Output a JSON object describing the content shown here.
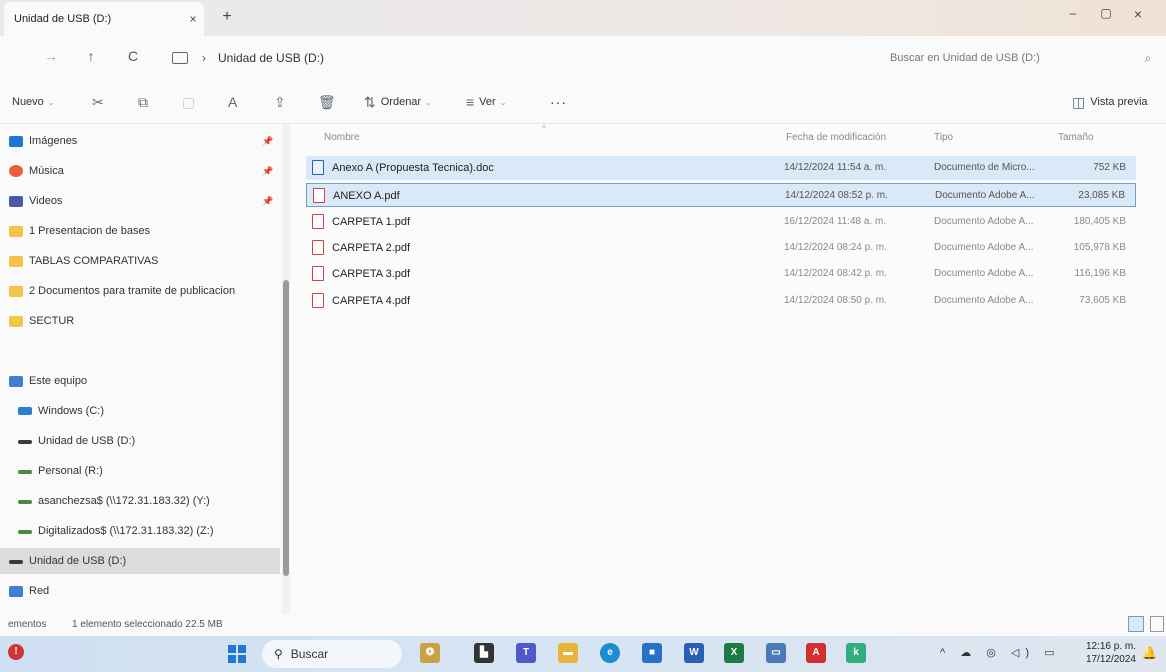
{
  "window": {
    "tab_title": "Unidad de USB (D:)",
    "tab_close": "×",
    "new_tab": "+",
    "minimize": "–",
    "maximize": "▢",
    "close": "×"
  },
  "address": {
    "back": "→",
    "up": "↑",
    "refresh": "C",
    "chevron": "›",
    "path": "Unidad de USB (D:)",
    "search_placeholder": "Buscar en Unidad de USB (D:)",
    "search_glyph": "⌕"
  },
  "toolbar": {
    "new_label": "Nuevo",
    "sort_label": "Ordenar",
    "view_label": "Ver",
    "more_label": "···",
    "preview_label": "Vista previa",
    "caret": "⌄",
    "icons": {
      "cut": "✂",
      "copy": "⧉",
      "paste": "▢",
      "rename": "A",
      "share": "⇪",
      "delete": "🗑",
      "sort": "⇅",
      "view": "≡",
      "preview": "◫"
    }
  },
  "sidebar": {
    "pin": "📌",
    "items": [
      {
        "label": "Imágenes",
        "icon": "images-icon"
      },
      {
        "label": "Música",
        "icon": "music-icon"
      },
      {
        "label": "Videos",
        "icon": "videos-icon"
      },
      {
        "label": "1 Presentacion de bases",
        "icon": "folder-icon"
      },
      {
        "label": "TABLAS COMPARATIVAS",
        "icon": "folder-icon"
      },
      {
        "label": "2 Documentos para tramite de publicacion",
        "icon": "folder-icon"
      },
      {
        "label": "SECTUR",
        "icon": "folder-icon"
      },
      {
        "label": "Este equipo",
        "icon": "pc-icon"
      },
      {
        "label": "Windows (C:)",
        "icon": "windows-drive-icon"
      },
      {
        "label": "Unidad de USB (D:)",
        "icon": "drive-icon"
      },
      {
        "label": "Personal (R:)",
        "icon": "network-drive-icon"
      },
      {
        "label": "asanchezsa$ (\\\\172.31.183.32) (Y:)",
        "icon": "network-drive-icon"
      },
      {
        "label": "Digitalizados$ (\\\\172.31.183.32) (Z:)",
        "icon": "network-drive-icon"
      },
      {
        "label": "Unidad de USB (D:)",
        "icon": "drive-icon"
      },
      {
        "label": "Red",
        "icon": "network-icon"
      }
    ]
  },
  "filelist": {
    "headers": {
      "name": "Nombre",
      "date": "Fecha de modificación",
      "type": "Tipo",
      "size": "Tamaño",
      "sort_arrow": "^"
    },
    "rows": [
      {
        "name": "Anexo A (Propuesta Tecnica).doc",
        "date": "14/12/2024 11:54 a. m.",
        "type": "Documento de Micro...",
        "size": "752 KB",
        "icon": "word-doc-icon"
      },
      {
        "name": "ANEXO A.pdf",
        "date": "14/12/2024 08:52 p. m.",
        "type": "Documento Adobe A...",
        "size": "23,085 KB",
        "icon": "pdf-icon"
      },
      {
        "name": "CARPETA 1.pdf",
        "date": "16/12/2024 11:48 a. m.",
        "type": "Documento Adobe A...",
        "size": "180,405 KB",
        "icon": "pdf-icon"
      },
      {
        "name": "CARPETA 2.pdf",
        "date": "14/12/2024 08:24 p. m.",
        "type": "Documento Adobe A...",
        "size": "105,978 KB",
        "icon": "pdf-icon"
      },
      {
        "name": "CARPETA 3.pdf",
        "date": "14/12/2024 08:42 p. m.",
        "type": "Documento Adobe A...",
        "size": "116,196 KB",
        "icon": "pdf-icon"
      },
      {
        "name": "CARPETA 4.pdf",
        "date": "14/12/2024 08:50 p. m.",
        "type": "Documento Adobe A...",
        "size": "73,605 KB",
        "icon": "pdf-icon"
      }
    ]
  },
  "status": {
    "count": "ementos",
    "selection": "1 elemento seleccionado  22.5 MB"
  },
  "taskbar": {
    "notification": "!",
    "search_label": "Buscar",
    "search_glyph": "⚲",
    "tray": "^ ☁ ◎ ◁) ▭",
    "time": "12:16 p. m.",
    "date": "17/12/2024",
    "bell": "🔔",
    "apps": [
      {
        "name": "widgets-icon",
        "glyph": "❂",
        "color": "#c8a048"
      },
      {
        "name": "task-view-icon",
        "glyph": "▙",
        "color": "#333333"
      },
      {
        "name": "teams-icon",
        "glyph": "T",
        "color": "#5059c9"
      },
      {
        "name": "file-explorer-icon",
        "glyph": "▬",
        "color": "#e8b53c"
      },
      {
        "name": "edge-icon",
        "glyph": "e",
        "color": "#1b8ed1"
      },
      {
        "name": "store-icon",
        "glyph": "■",
        "color": "#2572c6"
      },
      {
        "name": "word-icon",
        "glyph": "W",
        "color": "#2b5fb5"
      },
      {
        "name": "excel-icon",
        "glyph": "X",
        "color": "#1e7a45"
      },
      {
        "name": "drive-app-icon",
        "glyph": "▭",
        "color": "#4a7ab8"
      },
      {
        "name": "acrobat-icon",
        "glyph": "A",
        "color": "#d32f2f"
      },
      {
        "name": "k-app-icon",
        "glyph": "k",
        "color": "#2fae7e"
      }
    ]
  },
  "colors": {
    "selection": "#d9e9f7",
    "selection_border": "#6e9ec8",
    "sidebar_selected": "#dcdcdc",
    "accent": "#1f78d1"
  }
}
